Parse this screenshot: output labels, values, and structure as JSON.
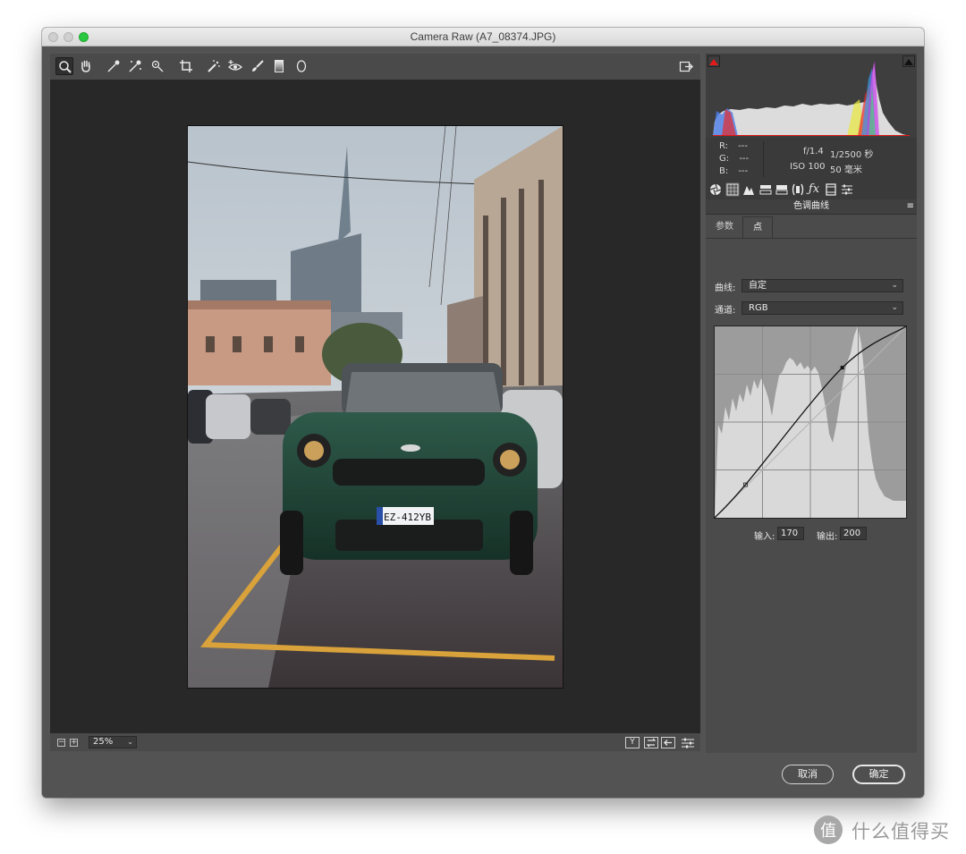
{
  "window": {
    "title": "Camera Raw (A7_08374.JPG)"
  },
  "toolbar": {
    "tools": [
      "zoom-icon",
      "hand-icon",
      "white-balance-icon",
      "color-sampler-icon",
      "targeted-adjustment-icon",
      "crop-icon",
      "spot-removal-icon",
      "red-eye-icon",
      "adjustment-brush-icon",
      "graduated-filter-icon",
      "radial-filter-icon"
    ],
    "open_preferences_icon": "open-in-photoshop-icon"
  },
  "statusbar": {
    "zoom": "25%",
    "zoom_out_symbol": "−",
    "zoom_in_symbol": "+",
    "before_after_label": "Y"
  },
  "info": {
    "r_label": "R:",
    "r_value": "---",
    "g_label": "G:",
    "g_value": "---",
    "b_label": "B:",
    "b_value": "---",
    "aperture": "f/1.4",
    "shutter": "1/2500 秒",
    "iso": "ISO 100",
    "focal": "50 毫米"
  },
  "panel": {
    "title": "色调曲线",
    "tabs": [
      "参数",
      "点"
    ],
    "active_tab": "点",
    "curve_label": "曲线:",
    "curve_value": "自定",
    "channel_label": "通道:",
    "channel_value": "RGB",
    "input_label": "输入:",
    "input_value": "170",
    "output_label": "输出:",
    "output_value": "200"
  },
  "curve_points": [
    {
      "input": 0,
      "output": 0
    },
    {
      "input": 41,
      "output": 44
    },
    {
      "input": 170,
      "output": 200
    },
    {
      "input": 255,
      "output": 255
    }
  ],
  "buttons": {
    "cancel": "取消",
    "ok": "确定"
  },
  "watermark": {
    "text": "什么值得买",
    "logo_glyph": "值"
  },
  "colors": {
    "traffic_green": "#2ac840",
    "clip_warning": "#e21a1a",
    "panel_bg": "#4b4b4b",
    "canvas_bg": "#282828"
  }
}
